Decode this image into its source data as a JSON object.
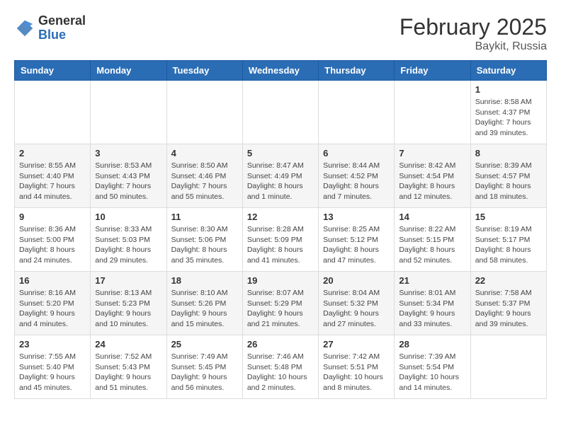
{
  "logo": {
    "general": "General",
    "blue": "Blue"
  },
  "title": "February 2025",
  "subtitle": "Baykit, Russia",
  "days_of_week": [
    "Sunday",
    "Monday",
    "Tuesday",
    "Wednesday",
    "Thursday",
    "Friday",
    "Saturday"
  ],
  "weeks": [
    {
      "days": [
        {
          "num": "",
          "info": ""
        },
        {
          "num": "",
          "info": ""
        },
        {
          "num": "",
          "info": ""
        },
        {
          "num": "",
          "info": ""
        },
        {
          "num": "",
          "info": ""
        },
        {
          "num": "",
          "info": ""
        },
        {
          "num": "1",
          "info": "Sunrise: 8:58 AM\nSunset: 4:37 PM\nDaylight: 7 hours and 39 minutes."
        }
      ]
    },
    {
      "days": [
        {
          "num": "2",
          "info": "Sunrise: 8:55 AM\nSunset: 4:40 PM\nDaylight: 7 hours and 44 minutes."
        },
        {
          "num": "3",
          "info": "Sunrise: 8:53 AM\nSunset: 4:43 PM\nDaylight: 7 hours and 50 minutes."
        },
        {
          "num": "4",
          "info": "Sunrise: 8:50 AM\nSunset: 4:46 PM\nDaylight: 7 hours and 55 minutes."
        },
        {
          "num": "5",
          "info": "Sunrise: 8:47 AM\nSunset: 4:49 PM\nDaylight: 8 hours and 1 minute."
        },
        {
          "num": "6",
          "info": "Sunrise: 8:44 AM\nSunset: 4:52 PM\nDaylight: 8 hours and 7 minutes."
        },
        {
          "num": "7",
          "info": "Sunrise: 8:42 AM\nSunset: 4:54 PM\nDaylight: 8 hours and 12 minutes."
        },
        {
          "num": "8",
          "info": "Sunrise: 8:39 AM\nSunset: 4:57 PM\nDaylight: 8 hours and 18 minutes."
        }
      ]
    },
    {
      "days": [
        {
          "num": "9",
          "info": "Sunrise: 8:36 AM\nSunset: 5:00 PM\nDaylight: 8 hours and 24 minutes."
        },
        {
          "num": "10",
          "info": "Sunrise: 8:33 AM\nSunset: 5:03 PM\nDaylight: 8 hours and 29 minutes."
        },
        {
          "num": "11",
          "info": "Sunrise: 8:30 AM\nSunset: 5:06 PM\nDaylight: 8 hours and 35 minutes."
        },
        {
          "num": "12",
          "info": "Sunrise: 8:28 AM\nSunset: 5:09 PM\nDaylight: 8 hours and 41 minutes."
        },
        {
          "num": "13",
          "info": "Sunrise: 8:25 AM\nSunset: 5:12 PM\nDaylight: 8 hours and 47 minutes."
        },
        {
          "num": "14",
          "info": "Sunrise: 8:22 AM\nSunset: 5:15 PM\nDaylight: 8 hours and 52 minutes."
        },
        {
          "num": "15",
          "info": "Sunrise: 8:19 AM\nSunset: 5:17 PM\nDaylight: 8 hours and 58 minutes."
        }
      ]
    },
    {
      "days": [
        {
          "num": "16",
          "info": "Sunrise: 8:16 AM\nSunset: 5:20 PM\nDaylight: 9 hours and 4 minutes."
        },
        {
          "num": "17",
          "info": "Sunrise: 8:13 AM\nSunset: 5:23 PM\nDaylight: 9 hours and 10 minutes."
        },
        {
          "num": "18",
          "info": "Sunrise: 8:10 AM\nSunset: 5:26 PM\nDaylight: 9 hours and 15 minutes."
        },
        {
          "num": "19",
          "info": "Sunrise: 8:07 AM\nSunset: 5:29 PM\nDaylight: 9 hours and 21 minutes."
        },
        {
          "num": "20",
          "info": "Sunrise: 8:04 AM\nSunset: 5:32 PM\nDaylight: 9 hours and 27 minutes."
        },
        {
          "num": "21",
          "info": "Sunrise: 8:01 AM\nSunset: 5:34 PM\nDaylight: 9 hours and 33 minutes."
        },
        {
          "num": "22",
          "info": "Sunrise: 7:58 AM\nSunset: 5:37 PM\nDaylight: 9 hours and 39 minutes."
        }
      ]
    },
    {
      "days": [
        {
          "num": "23",
          "info": "Sunrise: 7:55 AM\nSunset: 5:40 PM\nDaylight: 9 hours and 45 minutes."
        },
        {
          "num": "24",
          "info": "Sunrise: 7:52 AM\nSunset: 5:43 PM\nDaylight: 9 hours and 51 minutes."
        },
        {
          "num": "25",
          "info": "Sunrise: 7:49 AM\nSunset: 5:45 PM\nDaylight: 9 hours and 56 minutes."
        },
        {
          "num": "26",
          "info": "Sunrise: 7:46 AM\nSunset: 5:48 PM\nDaylight: 10 hours and 2 minutes."
        },
        {
          "num": "27",
          "info": "Sunrise: 7:42 AM\nSunset: 5:51 PM\nDaylight: 10 hours and 8 minutes."
        },
        {
          "num": "28",
          "info": "Sunrise: 7:39 AM\nSunset: 5:54 PM\nDaylight: 10 hours and 14 minutes."
        },
        {
          "num": "",
          "info": ""
        }
      ]
    }
  ]
}
